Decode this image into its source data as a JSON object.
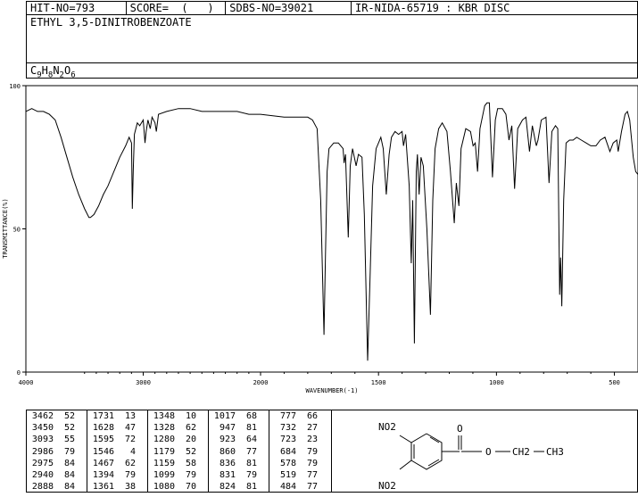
{
  "header": {
    "hit_no": "HIT-NO=793",
    "score": "SCORE=  (   )",
    "sdbs_no": "SDBS-NO=39021",
    "ir_id": "IR-NIDA-65719 : KBR DISC"
  },
  "compound_name": "ETHYL 3,5-DINITROBENZOATE",
  "formula": {
    "c": "C",
    "c_n": "9",
    "h": "H",
    "h_n": "8",
    "n": "N",
    "n_n": "2",
    "o": "O",
    "o_n": "6"
  },
  "structure": {
    "no2_top": "NO2",
    "no2_bottom": "NO2",
    "carbonyl_o": "O",
    "ester_o": "O",
    "ch2": "CH2",
    "ch3": "CH3"
  },
  "chart_data": {
    "type": "line",
    "xlabel": "WAVENUMBER(-1)",
    "ylabel": "TRANSMITTANCE(%)",
    "xlim": [
      4000,
      400
    ],
    "ylim": [
      0,
      100
    ],
    "xticks": [
      4000,
      3000,
      2000,
      1500,
      1000,
      500
    ],
    "yticks": [
      0,
      50,
      100
    ],
    "spectrum": [
      [
        4000,
        91
      ],
      [
        3950,
        92
      ],
      [
        3900,
        91
      ],
      [
        3850,
        91
      ],
      [
        3800,
        90
      ],
      [
        3750,
        88
      ],
      [
        3700,
        82
      ],
      [
        3650,
        75
      ],
      [
        3600,
        68
      ],
      [
        3550,
        62
      ],
      [
        3500,
        57
      ],
      [
        3462,
        54
      ],
      [
        3450,
        54
      ],
      [
        3420,
        55
      ],
      [
        3380,
        58
      ],
      [
        3340,
        62
      ],
      [
        3300,
        65
      ],
      [
        3250,
        70
      ],
      [
        3200,
        75
      ],
      [
        3150,
        79
      ],
      [
        3120,
        82
      ],
      [
        3100,
        80
      ],
      [
        3093,
        57
      ],
      [
        3085,
        70
      ],
      [
        3075,
        83
      ],
      [
        3050,
        87
      ],
      [
        3030,
        86
      ],
      [
        3000,
        88
      ],
      [
        2985,
        80
      ],
      [
        2975,
        84
      ],
      [
        2960,
        88
      ],
      [
        2940,
        85
      ],
      [
        2925,
        89
      ],
      [
        2900,
        87
      ],
      [
        2888,
        84
      ],
      [
        2870,
        90
      ],
      [
        2800,
        91
      ],
      [
        2700,
        92
      ],
      [
        2600,
        92
      ],
      [
        2500,
        91
      ],
      [
        2400,
        91
      ],
      [
        2300,
        91
      ],
      [
        2200,
        91
      ],
      [
        2100,
        90
      ],
      [
        2000,
        90
      ],
      [
        1900,
        89
      ],
      [
        1800,
        89
      ],
      [
        1780,
        88
      ],
      [
        1760,
        85
      ],
      [
        1745,
        60
      ],
      [
        1731,
        13
      ],
      [
        1725,
        40
      ],
      [
        1718,
        70
      ],
      [
        1710,
        78
      ],
      [
        1690,
        80
      ],
      [
        1670,
        80
      ],
      [
        1650,
        78
      ],
      [
        1646,
        73
      ],
      [
        1640,
        76
      ],
      [
        1628,
        47
      ],
      [
        1620,
        72
      ],
      [
        1610,
        78
      ],
      [
        1595,
        72
      ],
      [
        1585,
        76
      ],
      [
        1570,
        75
      ],
      [
        1560,
        55
      ],
      [
        1546,
        4
      ],
      [
        1535,
        35
      ],
      [
        1525,
        65
      ],
      [
        1510,
        78
      ],
      [
        1500,
        80
      ],
      [
        1490,
        82
      ],
      [
        1480,
        78
      ],
      [
        1467,
        62
      ],
      [
        1455,
        76
      ],
      [
        1445,
        82
      ],
      [
        1430,
        84
      ],
      [
        1415,
        83
      ],
      [
        1400,
        84
      ],
      [
        1394,
        79
      ],
      [
        1385,
        83
      ],
      [
        1370,
        65
      ],
      [
        1361,
        38
      ],
      [
        1355,
        60
      ],
      [
        1348,
        10
      ],
      [
        1340,
        70
      ],
      [
        1335,
        76
      ],
      [
        1328,
        62
      ],
      [
        1320,
        75
      ],
      [
        1310,
        72
      ],
      [
        1295,
        50
      ],
      [
        1280,
        20
      ],
      [
        1270,
        60
      ],
      [
        1260,
        78
      ],
      [
        1245,
        85
      ],
      [
        1230,
        87
      ],
      [
        1210,
        84
      ],
      [
        1195,
        70
      ],
      [
        1179,
        52
      ],
      [
        1170,
        66
      ],
      [
        1159,
        58
      ],
      [
        1150,
        78
      ],
      [
        1130,
        85
      ],
      [
        1110,
        84
      ],
      [
        1099,
        79
      ],
      [
        1090,
        80
      ],
      [
        1080,
        70
      ],
      [
        1070,
        85
      ],
      [
        1050,
        93
      ],
      [
        1040,
        94
      ],
      [
        1030,
        94
      ],
      [
        1017,
        68
      ],
      [
        1005,
        88
      ],
      [
        995,
        92
      ],
      [
        975,
        92
      ],
      [
        960,
        90
      ],
      [
        947,
        81
      ],
      [
        935,
        86
      ],
      [
        923,
        64
      ],
      [
        910,
        85
      ],
      [
        890,
        88
      ],
      [
        875,
        89
      ],
      [
        860,
        77
      ],
      [
        848,
        86
      ],
      [
        836,
        81
      ],
      [
        831,
        79
      ],
      [
        824,
        81
      ],
      [
        810,
        88
      ],
      [
        790,
        89
      ],
      [
        777,
        66
      ],
      [
        765,
        84
      ],
      [
        750,
        86
      ],
      [
        740,
        85
      ],
      [
        732,
        27
      ],
      [
        728,
        40
      ],
      [
        723,
        23
      ],
      [
        715,
        60
      ],
      [
        705,
        80
      ],
      [
        690,
        81
      ],
      [
        675,
        81
      ],
      [
        660,
        82
      ],
      [
        640,
        81
      ],
      [
        620,
        80
      ],
      [
        600,
        79
      ],
      [
        584,
        79
      ],
      [
        578,
        79
      ],
      [
        560,
        81
      ],
      [
        540,
        82
      ],
      [
        519,
        77
      ],
      [
        505,
        80
      ],
      [
        490,
        81
      ],
      [
        484,
        77
      ],
      [
        470,
        84
      ],
      [
        455,
        90
      ],
      [
        445,
        91
      ],
      [
        435,
        88
      ],
      [
        420,
        75
      ],
      [
        410,
        70
      ],
      [
        400,
        69
      ]
    ],
    "peak_columns": [
      [
        [
          "3462",
          "52"
        ],
        [
          "3450",
          "52"
        ],
        [
          "3093",
          "55"
        ],
        [
          "2986",
          "79"
        ],
        [
          "2975",
          "84"
        ],
        [
          "2940",
          "84"
        ],
        [
          "2888",
          "84"
        ]
      ],
      [
        [
          "1731",
          "13"
        ],
        [
          "1628",
          "47"
        ],
        [
          "1595",
          "72"
        ],
        [
          "1546",
          "4"
        ],
        [
          "1467",
          "62"
        ],
        [
          "1394",
          "79"
        ],
        [
          "1361",
          "38"
        ]
      ],
      [
        [
          "1348",
          "10"
        ],
        [
          "1328",
          "62"
        ],
        [
          "1280",
          "20"
        ],
        [
          "1179",
          "52"
        ],
        [
          "1159",
          "58"
        ],
        [
          "1099",
          "79"
        ],
        [
          "1080",
          "70"
        ]
      ],
      [
        [
          "1017",
          "68"
        ],
        [
          "947",
          "81"
        ],
        [
          "923",
          "64"
        ],
        [
          "860",
          "77"
        ],
        [
          "836",
          "81"
        ],
        [
          "831",
          "79"
        ],
        [
          "824",
          "81"
        ]
      ],
      [
        [
          "777",
          "66"
        ],
        [
          "732",
          "27"
        ],
        [
          "723",
          "23"
        ],
        [
          "684",
          "79"
        ],
        [
          "578",
          "79"
        ],
        [
          "519",
          "77"
        ],
        [
          "484",
          "77"
        ]
      ]
    ]
  }
}
